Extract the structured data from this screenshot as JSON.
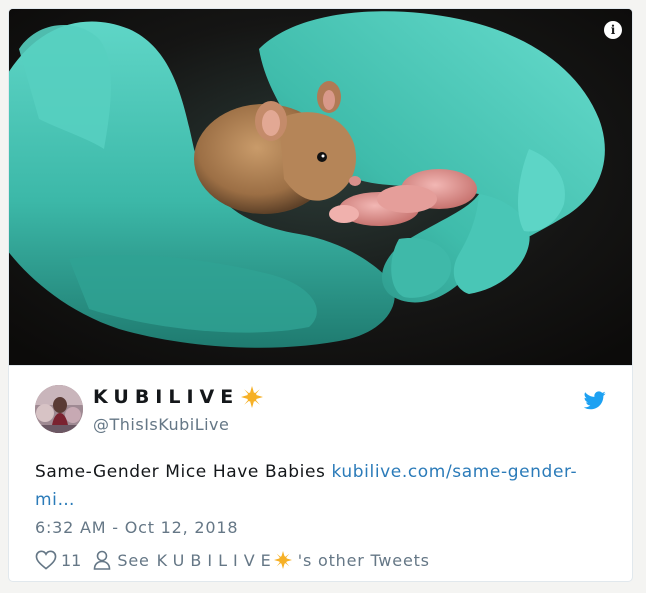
{
  "media": {
    "alt": "photo",
    "info_label": "i"
  },
  "tweet": {
    "user_name": "KUBILIVE",
    "user_handle": "@ThisIsKubiLive",
    "text": "Same-Gender Mice Have Babies ",
    "link_text": "kubilive.com/same-gender-mi…",
    "timestamp": "6:32 AM - Oct 12, 2018",
    "likes": "11",
    "see_prefix": "See",
    "see_name": "KUBILIVE",
    "see_suffix": "'s other Tweets"
  },
  "colors": {
    "link": "#2b7bb9",
    "muted": "#657786",
    "twitter_blue": "#1da1f2",
    "badge": "#f6b025"
  },
  "icons": [
    "info-icon",
    "verified-sun-badge-icon",
    "twitter-bird-icon",
    "heart-icon",
    "person-icon"
  ]
}
